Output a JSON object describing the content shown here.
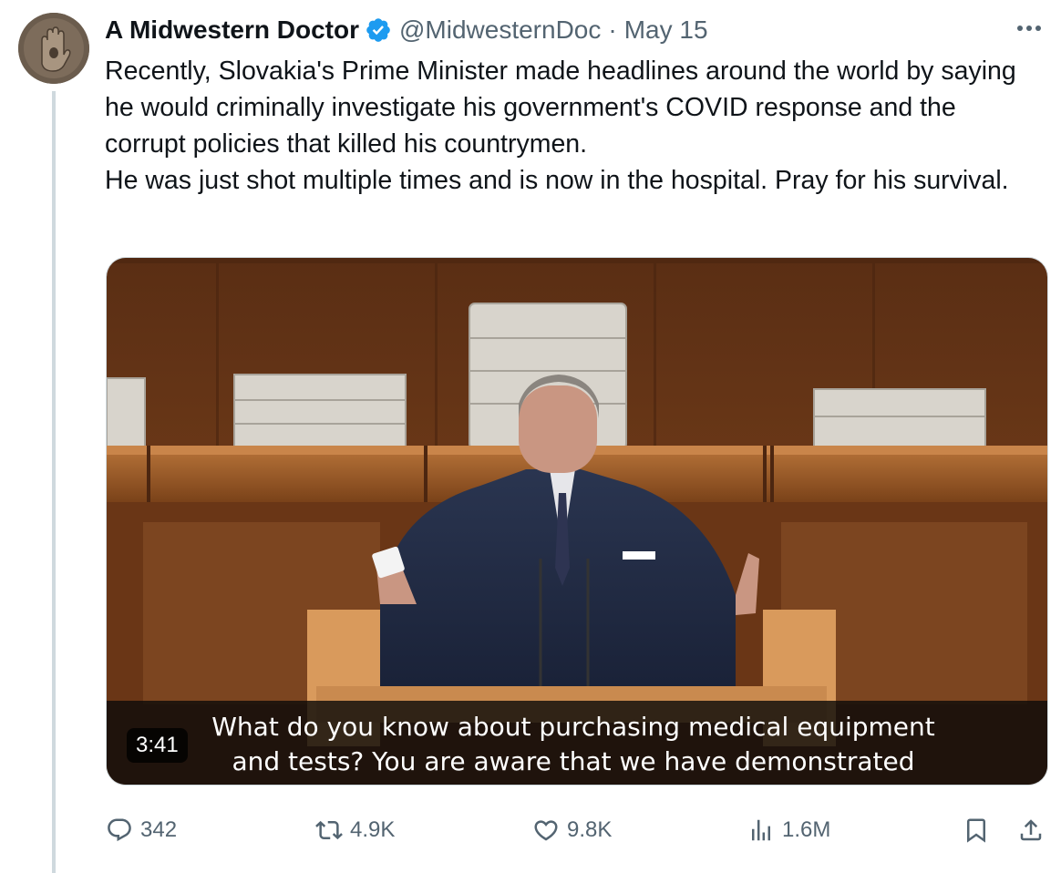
{
  "author": {
    "name": "A Midwestern Doctor",
    "handle": "@MidwesternDoc",
    "separator": "·",
    "date": "May 15",
    "verified": true,
    "avatar_icon": "hand-sculpture-avatar"
  },
  "tweet": {
    "paragraphs": [
      "Recently, Slovakia's Prime Minister made headlines around the world by saying he would criminally investigate his government's COVID response and the corrupt policies that killed his countrymen.",
      "He was just shot multiple times and is now in the hospital. Pray for his survival."
    ]
  },
  "video": {
    "duration": "3:41",
    "subtitle_line1": "What do you know about purchasing medical equipment",
    "subtitle_line2": "and tests? You are aware that we have demonstrated"
  },
  "actions": {
    "replies": "342",
    "reposts": "4.9K",
    "likes": "9.8K",
    "views": "1.6M"
  },
  "colors": {
    "text_primary": "#0f1419",
    "text_secondary": "#536471",
    "verified_badge": "#1d9bf0",
    "thread_line": "#cfd9de"
  }
}
